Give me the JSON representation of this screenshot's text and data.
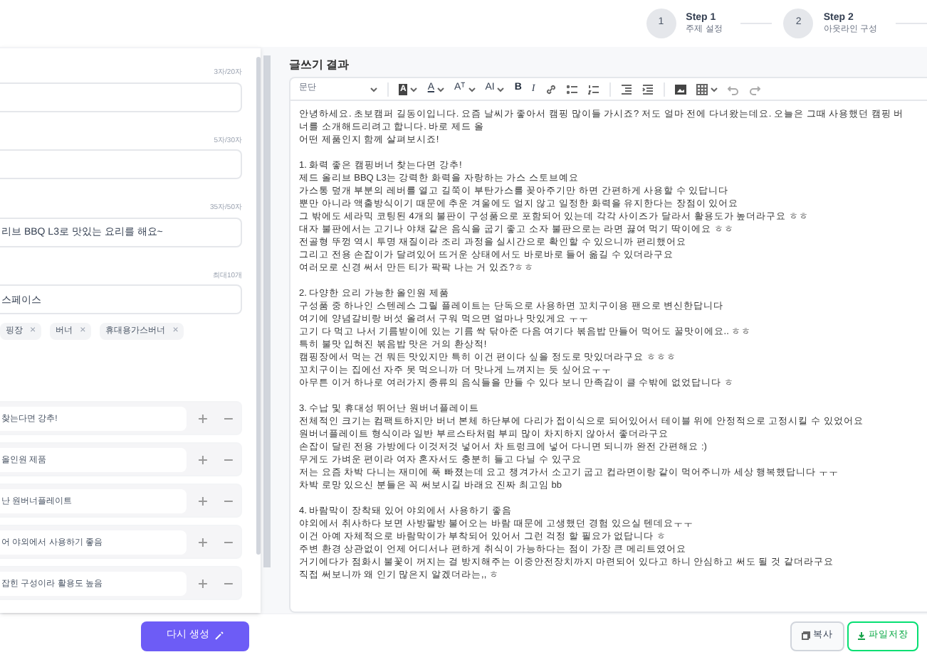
{
  "steps": [
    {
      "number": "1",
      "title": "Step 1",
      "subtitle": "주제 설정"
    },
    {
      "number": "2",
      "title": "Step 2",
      "subtitle": "아웃라인 구성"
    }
  ],
  "form": {
    "fields": [
      {
        "counter": "3자/20자"
      },
      {
        "counter": "5자/30자"
      },
      {
        "counter": "35자/50자",
        "value": "리브 BBQ L3로 맛있는 요리를 해요~"
      },
      {
        "counter": "최대10개",
        "value": "스페이스"
      }
    ],
    "tags": [
      {
        "label": "핑장",
        "remove": "×"
      },
      {
        "label": "버너",
        "remove": "×"
      },
      {
        "label": "휴대용가스버너",
        "remove": "×"
      }
    ]
  },
  "outline": {
    "items": [
      {
        "text": "찾는다면 강추!"
      },
      {
        "text": "올인원 제품"
      },
      {
        "text": "난 원버너플레이트"
      },
      {
        "text": "어 야외에서 사용하기 좋음"
      },
      {
        "text": "잡힌 구성이라 활용도 높음"
      }
    ]
  },
  "regenerate_button": "다시 생성",
  "editor": {
    "title": "글쓰기 결과",
    "block_format": "문단",
    "toolbar": [
      {
        "kind": "separator"
      },
      {
        "kind": "highlight",
        "glyph": "A",
        "menu": true
      },
      {
        "kind": "font-color",
        "glyph": "A",
        "menu": true
      },
      {
        "kind": "font-size",
        "glyph": "Aᵀ",
        "menu": true
      },
      {
        "kind": "line-height",
        "glyph": "AI",
        "menu": true
      },
      {
        "kind": "bold",
        "glyph": "B"
      },
      {
        "kind": "italic",
        "glyph": "I"
      },
      {
        "kind": "link"
      },
      {
        "kind": "bullet-list"
      },
      {
        "kind": "numbered-list"
      },
      {
        "kind": "separator"
      },
      {
        "kind": "outdent"
      },
      {
        "kind": "indent"
      },
      {
        "kind": "separator"
      },
      {
        "kind": "image"
      },
      {
        "kind": "table",
        "menu": true
      },
      {
        "kind": "undo"
      },
      {
        "kind": "redo"
      }
    ],
    "paragraphs": [
      [
        "안녕하세요. 초보캠퍼 길동이입니다. 요즘 날씨가 좋아서 캠핑 많이들 가시죠? 저도 얼마 전에 다녀왔는데요. 오늘은 그때 사용했던 캠핑 버너를 소개해드리려고 합니다. 바로 제드 올",
        "어떤 제품인지 함께 살펴보시죠!"
      ],
      [
        "1. 화력 좋은 캠핑버너 찾는다면 강추!",
        "제드 올리브 BBQ L3는 강력한 화력을 자랑하는 가스 스토브예요",
        "가스통 덮개 부분의 레버를 열고 길쭉이 부탄가스를 꽂아주기만 하면 간편하게 사용할 수 있답니다",
        "뿐만 아니라 액출방식이기 때문에 추운 겨울에도 얼지 않고 일정한 화력을 유지한다는 장점이 있어요",
        "그 밖에도 세라믹 코팅된 4개의 불판이 구성품으로 포함되어 있는데 각각 사이즈가 달라서 활용도가 높더라구요 ㅎㅎ",
        "대자 불판에서는 고기나 야채 같은 음식을 굽기 좋고 소자 불판으로는 라면 끓여 먹기 딱이에요 ㅎㅎ",
        "전골형 뚜껑 역시 투명 재질이라 조리 과정을 실시간으로 확인할 수 있으니까 편리했어요",
        "그리고 전용 손잡이가 달려있어 뜨거운 상태에서도 바로바로 들어 옮길 수 있더라구요",
        "여러모로 신경 써서 만든 티가 팍팍 나는 거 있죠?ㅎㅎ"
      ],
      [
        "2. 다양한 요리 가능한 올인원 제품",
        "구성품 중 하나인 스텐레스 그릴 플레이트는 단독으로 사용하면 꼬치구이용 팬으로 변신한답니다",
        "여기에 양념갈비랑 버섯 올려서 구워 먹으면 얼마나 맛있게요 ㅜㅜ",
        "고기 다 먹고 나서 기름받이에 있는 기름 싹 닦아준 다음 여기다 볶음밥 만들어 먹어도 꿀맛이에요.. ㅎㅎ",
        "특히 불맛 입혀진 볶음밥 맛은 거의 환상적!",
        "캠핑장에서 먹는 건 뭐든 맛있지만 특히 이건 편이다 싶을 정도로 맛있더라구요 ㅎㅎㅎ",
        "꼬치구이는 집에선 자주 못 먹으니까 더 맛나게 느껴지는 듯 싶어요ㅜㅜ",
        "아무튼 이거 하나로 여러가지 종류의 음식들을 만들 수 있다 보니 만족감이 클 수밖에 없었답니다 ㅎ"
      ],
      [
        "3. 수납 및 휴대성 뛰어난 원버너플레이트",
        "전체적인 크기는 컴팩트하지만 버너 본체 하단부에 다리가 접이식으로 되어있어서 테이블 위에 안정적으로 고정시킬 수 있었어요",
        "원버너플레이트 형식이라 일반 부르스타처럼 부피 많이 차지하지 않아서 좋더라구요",
        "손잡이 달린 전용 가방에다 이것저것 넣어서 차 트렁크에 넣어 다니면 되니까 완전 간편해요 :)",
        "무게도 가벼운 편이라 여자 혼자서도 충분히 들고 다닐 수 있구요",
        "저는 요즘 차박 다니는 재미에 푹 빠졌는데 요고 챙겨가서 소고기 굽고 컵라면이랑 같이 먹어주니까 세상 행복했답니다 ㅜㅜ",
        "차박 로망 있으신 분들은 꼭 써보시길 바래요 진짜 최고임 bb"
      ],
      [
        "4. 바람막이 장착돼 있어 야외에서 사용하기 좋음",
        "야외에서 취사하다 보면 사방팔방 불어오는 바람 때문에 고생했던 경험 있으실 텐데요ㅜㅜ",
        "이건 아예 자체적으로 바람막이가 부착되어 있어서 그런 걱정 할 필요가 없답니다 ㅎ",
        "주변 환경 상관없이 언제 어디서나 편하게 취식이 가능하다는 점이 가장 큰 메리트였어요",
        "거기에다가 점화시 불꽃이 꺼지는 걸 방지해주는 이중안전장치까지 마련되어 있다고 하니 안심하고 써도 될 것 같더라구요",
        "직접 써보니까 왜 인기 많은지 알겠더라는,, ㅎ"
      ]
    ]
  },
  "actions": [
    {
      "kind": "copy",
      "label": "복사"
    },
    {
      "kind": "save",
      "label": "파일저장"
    }
  ]
}
